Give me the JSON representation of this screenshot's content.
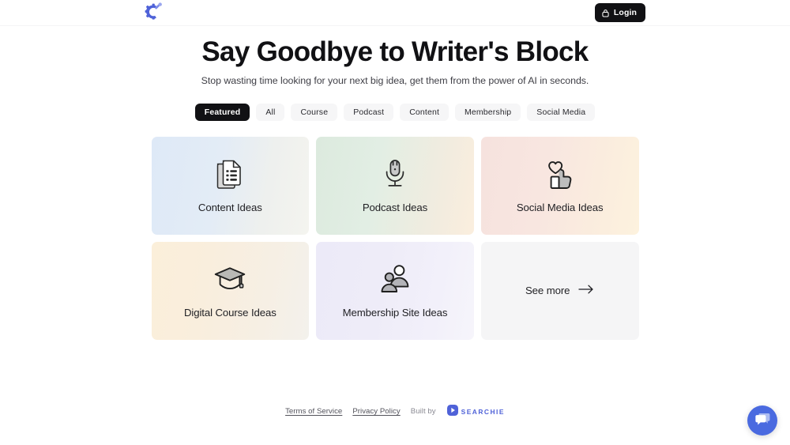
{
  "header": {
    "logo_icon": "searchie-gear-logo-icon",
    "login_label": "Login",
    "lock_icon": "lock-icon"
  },
  "hero": {
    "title": "Say Goodbye to Writer's Block",
    "subtitle": "Stop wasting time looking for your next big idea, get them from the power of AI in seconds."
  },
  "filters": {
    "items": [
      {
        "label": "Featured",
        "active": true
      },
      {
        "label": "All",
        "active": false
      },
      {
        "label": "Course",
        "active": false
      },
      {
        "label": "Podcast",
        "active": false
      },
      {
        "label": "Content",
        "active": false
      },
      {
        "label": "Membership",
        "active": false
      },
      {
        "label": "Social Media",
        "active": false
      }
    ]
  },
  "cards": [
    {
      "label": "Content Ideas",
      "icon": "document-list-icon"
    },
    {
      "label": "Podcast Ideas",
      "icon": "microphone-icon"
    },
    {
      "label": "Social Media Ideas",
      "icon": "heart-thumbs-up-icon"
    },
    {
      "label": "Digital Course Ideas",
      "icon": "graduation-cap-icon"
    },
    {
      "label": "Membership Site Ideas",
      "icon": "two-people-icon"
    }
  ],
  "see_more": {
    "label": "See more",
    "icon": "arrow-right-icon"
  },
  "footer": {
    "terms_label": "Terms of Service",
    "privacy_label": "Privacy Policy",
    "built_by_label": "Built by",
    "brand_name": "SEARCHIE",
    "brand_icon": "searchie-play-icon"
  },
  "chat": {
    "icon": "chat-bubbles-icon"
  },
  "colors": {
    "accent_blue": "#4f62d8",
    "chat_blue": "#4a6ae0",
    "active_pill": "#111114",
    "pill_bg": "#f6f6f7"
  }
}
